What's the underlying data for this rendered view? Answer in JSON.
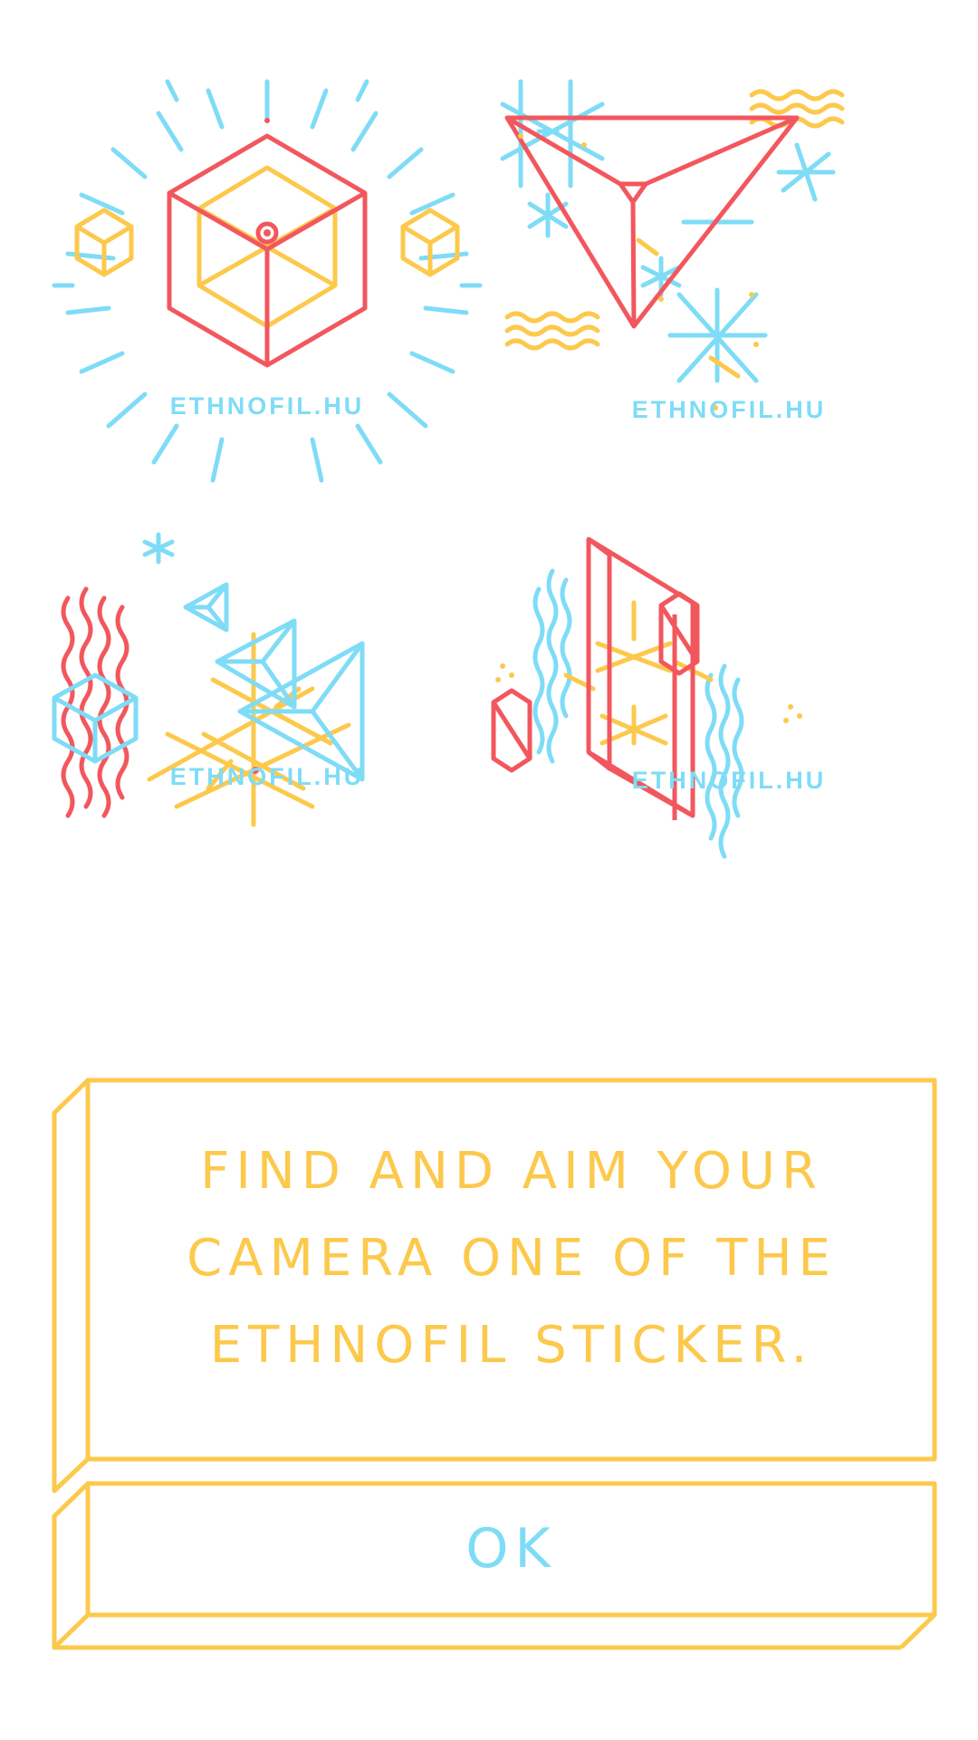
{
  "colors": {
    "red": "#F2575E",
    "yellow": "#FCC94C",
    "blue": "#7FDCF6",
    "background": "#FFFFFF"
  },
  "stickers": [
    {
      "label": "ETHNOFIL.HU",
      "icon": "cube-sunburst-sticker"
    },
    {
      "label": "ETHNOFIL.HU",
      "icon": "triangle-snowflake-sticker"
    },
    {
      "label": "ETHNOFIL.HU",
      "icon": "wave-tetrahedron-sticker"
    },
    {
      "label": "ETHNOFIL.HU",
      "icon": "crystal-prism-sticker"
    }
  ],
  "instruction": {
    "lines": [
      "FIND AND AIM YOUR",
      "CAMERA ONE OF THE",
      "ETHNOFIL STICKER."
    ]
  },
  "ok_button": {
    "label": "OK"
  }
}
